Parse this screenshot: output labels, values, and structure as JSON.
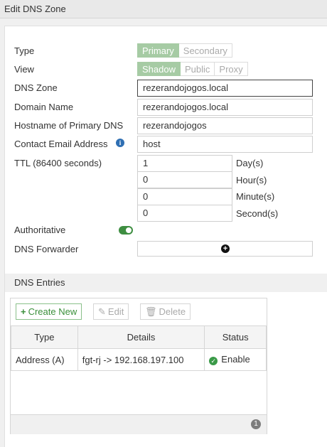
{
  "header": {
    "title": "Edit DNS Zone"
  },
  "form": {
    "type": {
      "label": "Type",
      "options": [
        "Primary",
        "Secondary"
      ],
      "selected": "Primary"
    },
    "view": {
      "label": "View",
      "options": [
        "Shadow",
        "Public",
        "Proxy"
      ],
      "selected": "Shadow"
    },
    "dns_zone": {
      "label": "DNS Zone",
      "value": "rezerandojogos.local"
    },
    "domain_name": {
      "label": "Domain Name",
      "value": "rezerandojogos.local"
    },
    "hostname": {
      "label": "Hostname of Primary DNS",
      "value": "rezerandojogos"
    },
    "contact_email": {
      "label": "Contact Email Address",
      "value": "host"
    },
    "ttl": {
      "label": "TTL (86400 seconds)",
      "fields": [
        {
          "value": "1",
          "unit": "Day(s)"
        },
        {
          "value": "0",
          "unit": "Hour(s)"
        },
        {
          "value": "0",
          "unit": "Minute(s)"
        },
        {
          "value": "0",
          "unit": "Second(s)"
        }
      ]
    },
    "authoritative": {
      "label": "Authoritative",
      "enabled": true
    },
    "dns_forwarder": {
      "label": "DNS Forwarder"
    }
  },
  "dns_entries": {
    "title": "DNS Entries",
    "toolbar": {
      "create": "Create New",
      "edit": "Edit",
      "delete": "Delete"
    },
    "columns": [
      "Type",
      "Details",
      "Status"
    ],
    "rows": [
      {
        "type": "Address (A)",
        "details": "fgt-rj -> 192.168.197.100",
        "status": "Enable"
      }
    ],
    "count": "1"
  },
  "colors": {
    "accent": "#a6cba4",
    "success": "#3a9a48",
    "info": "#2f6fb3"
  }
}
